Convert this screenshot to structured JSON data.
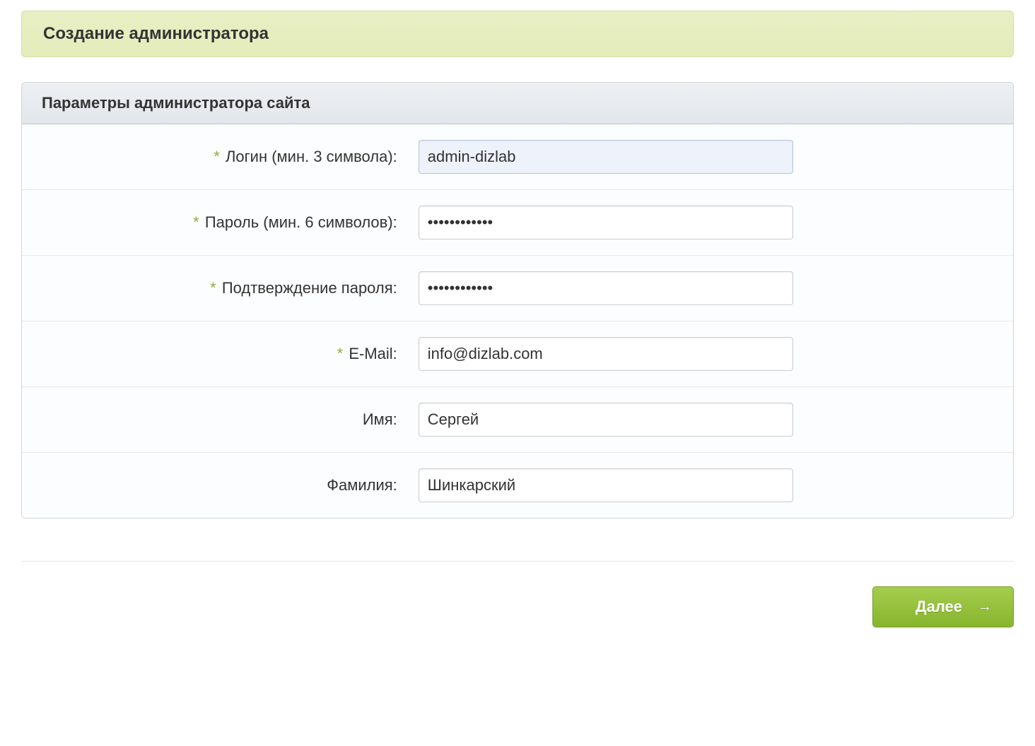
{
  "page_title": "Создание администратора",
  "panel_title": "Параметры администратора сайта",
  "fields": {
    "login": {
      "label": "Логин (мин. 3 символа):",
      "required": true,
      "value": "admin-dizlab"
    },
    "password": {
      "label": "Пароль (мин. 6 символов):",
      "required": true,
      "value": "••••••••••••"
    },
    "password_confirm": {
      "label": "Подтверждение пароля:",
      "required": true,
      "value": "••••••••••••"
    },
    "email": {
      "label": "E-Mail:",
      "required": true,
      "value": "info@dizlab.com"
    },
    "firstname": {
      "label": "Имя:",
      "required": false,
      "value": "Сергей"
    },
    "lastname": {
      "label": "Фамилия:",
      "required": false,
      "value": "Шинкарский"
    }
  },
  "button_next": "Далее"
}
